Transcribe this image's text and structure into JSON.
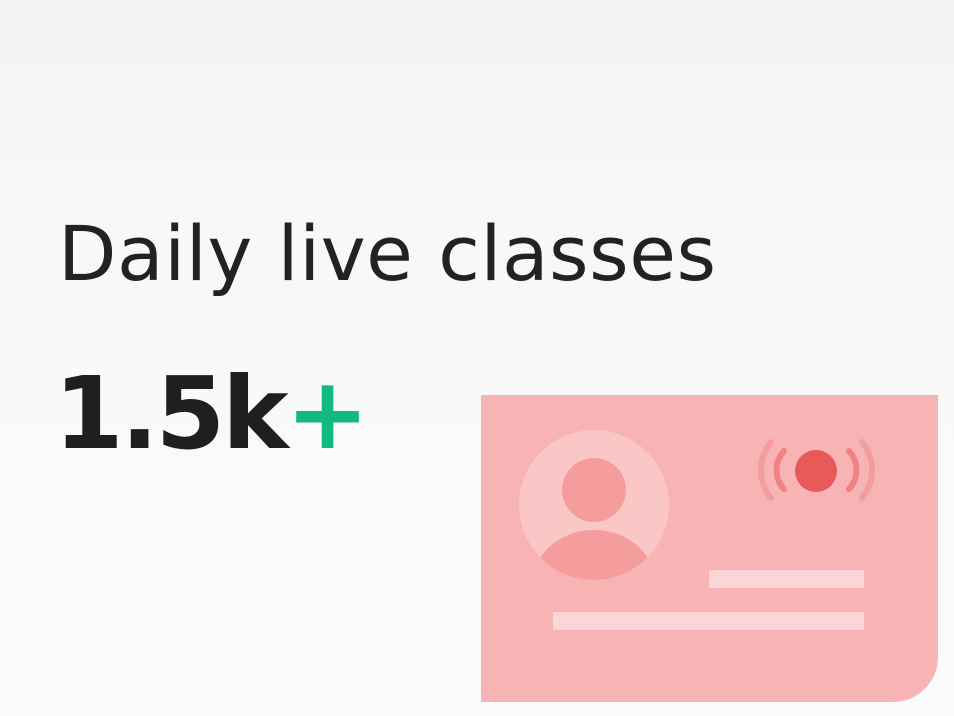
{
  "card": {
    "title": "Daily live classes",
    "stat_value": "1.5k",
    "stat_suffix": "+",
    "accent_color": "#13b982"
  },
  "illustration": {
    "description_icons": [
      "user-avatar-icon",
      "live-broadcast-icon"
    ],
    "panel_color": "#f8b4b4",
    "live_dot_color": "#e85a5a"
  }
}
